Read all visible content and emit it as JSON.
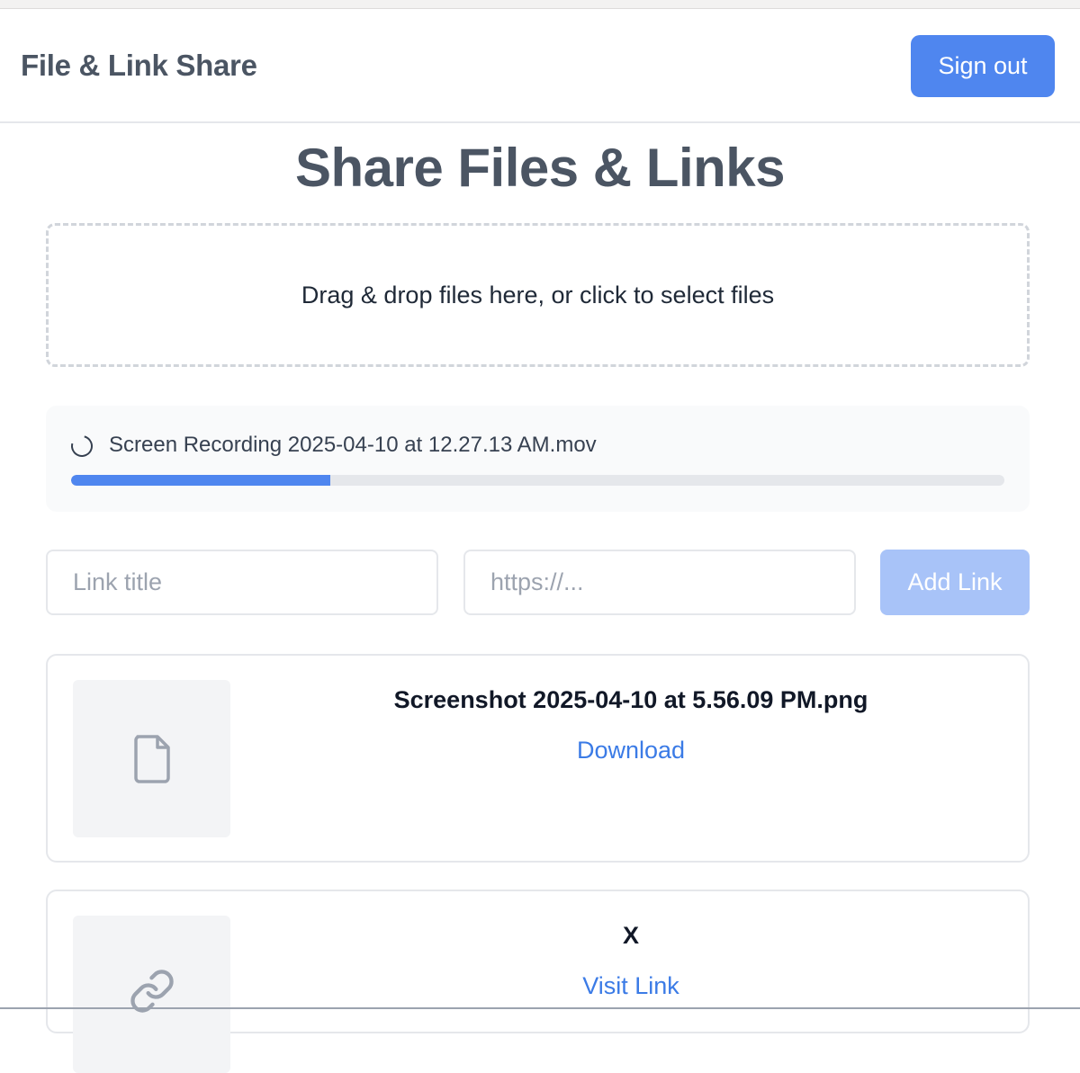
{
  "header": {
    "brand": "File & Link Share",
    "signout_label": "Sign out"
  },
  "main": {
    "title": "Share Files & Links",
    "dropzone_text": "Drag & drop files here, or click to select files"
  },
  "upload": {
    "file_name": "Screen Recording 2025-04-10 at 12.27.13 AM.mov",
    "progress_percent": 27.8,
    "icon": "spinner-icon"
  },
  "link_form": {
    "title_placeholder": "Link title",
    "url_placeholder": "https://...",
    "title_value": "",
    "url_value": "",
    "add_label": "Add Link"
  },
  "items": [
    {
      "type": "file",
      "icon": "file-icon",
      "title": "Screenshot 2025-04-10 at 5.56.09 PM.png",
      "action_label": "Download"
    },
    {
      "type": "link",
      "icon": "link-icon",
      "title": "X",
      "action_label": "Visit Link"
    }
  ],
  "colors": {
    "accent": "#4f86ef",
    "accent_disabled": "#a8c3f8",
    "link": "#3b7be6",
    "heading": "#4b5563"
  }
}
